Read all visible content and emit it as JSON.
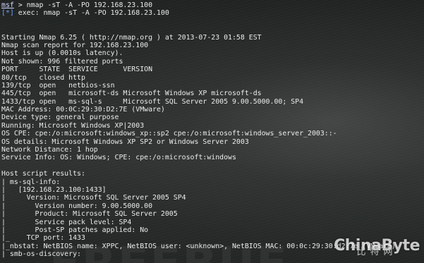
{
  "prompt": {
    "tag": "msf",
    "command": " > nmap -sT -A -PO 192.168.23.100"
  },
  "exec_line": {
    "tag": "[*]",
    "text": " exec: nmap -sT -A -PO 192.168.23.100"
  },
  "output": [
    "",
    "",
    "Starting Nmap 6.25 ( http://nmap.org ) at 2013-07-23 01:58 EST",
    "Nmap scan report for 192.168.23.100",
    "Host is up (0.0010s latency).",
    "Not shown: 996 filtered ports",
    "PORT     STATE  SERVICE      VERSION",
    "80/tcp   closed http",
    "139/tcp  open   netbios-ssn",
    "445/tcp  open   microsoft-ds Microsoft Windows XP microsoft-ds",
    "1433/tcp open   ms-sql-s     Microsoft SQL Server 2005 9.00.5000.00; SP4",
    "MAC Address: 00:0C:29:30:D2:7E (VMware)",
    "Device type: general purpose",
    "Running: Microsoft Windows XP|2003",
    "OS CPE: cpe:/o:microsoft:windows_xp::sp2 cpe:/o:microsoft:windows_server_2003::-",
    "OS details: Microsoft Windows XP SP2 or Windows Server 2003",
    "Network Distance: 1 hop",
    "Service Info: OS: Windows; CPE: cpe:/o:microsoft:windows",
    "",
    "Host script results:",
    "| ms-sql-info:",
    "|   [192.168.23.100:1433]",
    "|     Version: Microsoft SQL Server 2005 SP4",
    "|       Version number: 9.00.5000.00",
    "|       Product: Microsoft SQL Server 2005",
    "|       Service pack level: SP4",
    "|       Post-SP patches applied: No",
    "|_    TCP port: 1433",
    "|_nbstat: NetBIOS name: XPPC, NetBIOS user: <unknown>, NetBIOS MAC: 00:0c:29:30:d2:7e (VMware)",
    "| smb-os-discovery:"
  ],
  "watermark": {
    "brand": "ChinaByte",
    "cn": "比特网"
  },
  "colors": {
    "text": "#e8ecea",
    "prompt_tag": "#cfd6ff",
    "info_tag": "#6fa0ff",
    "background": "#2a2d2c"
  }
}
